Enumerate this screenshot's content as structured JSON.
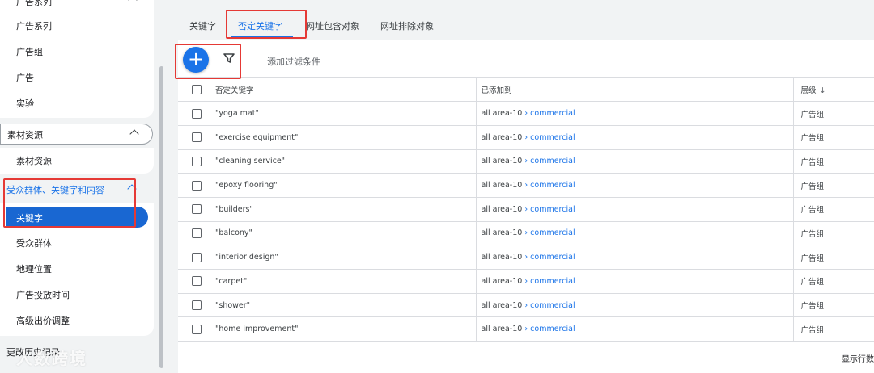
{
  "sidebar": {
    "top_section_label": "广告系列",
    "items_top": [
      "广告系列",
      "广告组",
      "广告",
      "实验"
    ],
    "assets_header": "素材资源",
    "assets_item": "素材资源",
    "audience_header": "受众群体、关键字和内容",
    "active_item": "关键字",
    "audience_items": [
      "受众群体",
      "地理位置",
      "广告投放时间",
      "高级出价调整"
    ],
    "history": "更改历史记录",
    "watermark": "人数跨境"
  },
  "tabs": [
    "关键字",
    "否定关键字",
    "网址包含对象",
    "网址排除对象"
  ],
  "active_tab": "否定关键字",
  "toolbar": {
    "add_label": "+",
    "filter_label": "添加过滤条件"
  },
  "table": {
    "headers": {
      "keyword": "否定关键字",
      "added_to": "已添加到",
      "level": "层级"
    },
    "rows": [
      {
        "keyword": "\"yoga mat\"",
        "campaign": "all area-10",
        "sep": " › ",
        "adgroup": "commercial",
        "level": "广告组"
      },
      {
        "keyword": "\"exercise equipment\"",
        "campaign": "all area-10",
        "sep": " › ",
        "adgroup": "commercial",
        "level": "广告组"
      },
      {
        "keyword": "\"cleaning service\"",
        "campaign": "all area-10",
        "sep": " › ",
        "adgroup": "commercial",
        "level": "广告组"
      },
      {
        "keyword": "\"epoxy flooring\"",
        "campaign": "all area-10",
        "sep": " › ",
        "adgroup": "commercial",
        "level": "广告组"
      },
      {
        "keyword": "\"builders\"",
        "campaign": "all area-10",
        "sep": " › ",
        "adgroup": "commercial",
        "level": "广告组"
      },
      {
        "keyword": "\"balcony\"",
        "campaign": "all area-10",
        "sep": " › ",
        "adgroup": "commercial",
        "level": "广告组"
      },
      {
        "keyword": "\"interior design\"",
        "campaign": "all area-10",
        "sep": " › ",
        "adgroup": "commercial",
        "level": "广告组"
      },
      {
        "keyword": "\"carpet\"",
        "campaign": "all area-10",
        "sep": " › ",
        "adgroup": "commercial",
        "level": "广告组"
      },
      {
        "keyword": "\"shower\"",
        "campaign": "all area-10",
        "sep": " › ",
        "adgroup": "commercial",
        "level": "广告组"
      },
      {
        "keyword": "\"home improvement\"",
        "campaign": "all area-10",
        "sep": " › ",
        "adgroup": "commercial",
        "level": "广告组"
      }
    ],
    "footer": "显示行数"
  },
  "colors": {
    "accent": "#1a73e8",
    "highlight": "#e53935"
  }
}
